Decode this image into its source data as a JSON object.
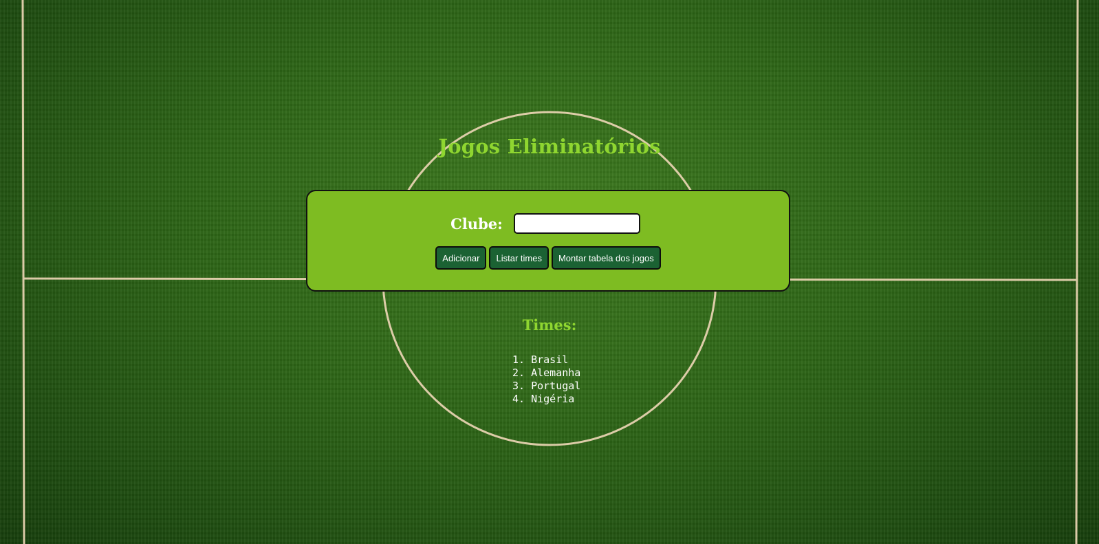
{
  "header": {
    "title": "Jogos Eliminatórios"
  },
  "form": {
    "club_label": "Clube:",
    "club_input_value": "",
    "club_input_placeholder": ""
  },
  "buttons": {
    "add": "Adicionar",
    "list": "Listar times",
    "schedule": "Montar tabela dos jogos"
  },
  "teams": {
    "title": "Times:",
    "items": [
      {
        "number": "1.",
        "name": "Brasil"
      },
      {
        "number": "2.",
        "name": "Alemanha"
      },
      {
        "number": "3.",
        "name": "Portugal"
      },
      {
        "number": "4.",
        "name": "Nigéria"
      }
    ]
  },
  "colors": {
    "title_accent": "#8fd630",
    "panel_background": "#7ebc22",
    "button_background": "#1b6233",
    "field_lines": "#e6d2b0",
    "grass": "#2d6516"
  }
}
